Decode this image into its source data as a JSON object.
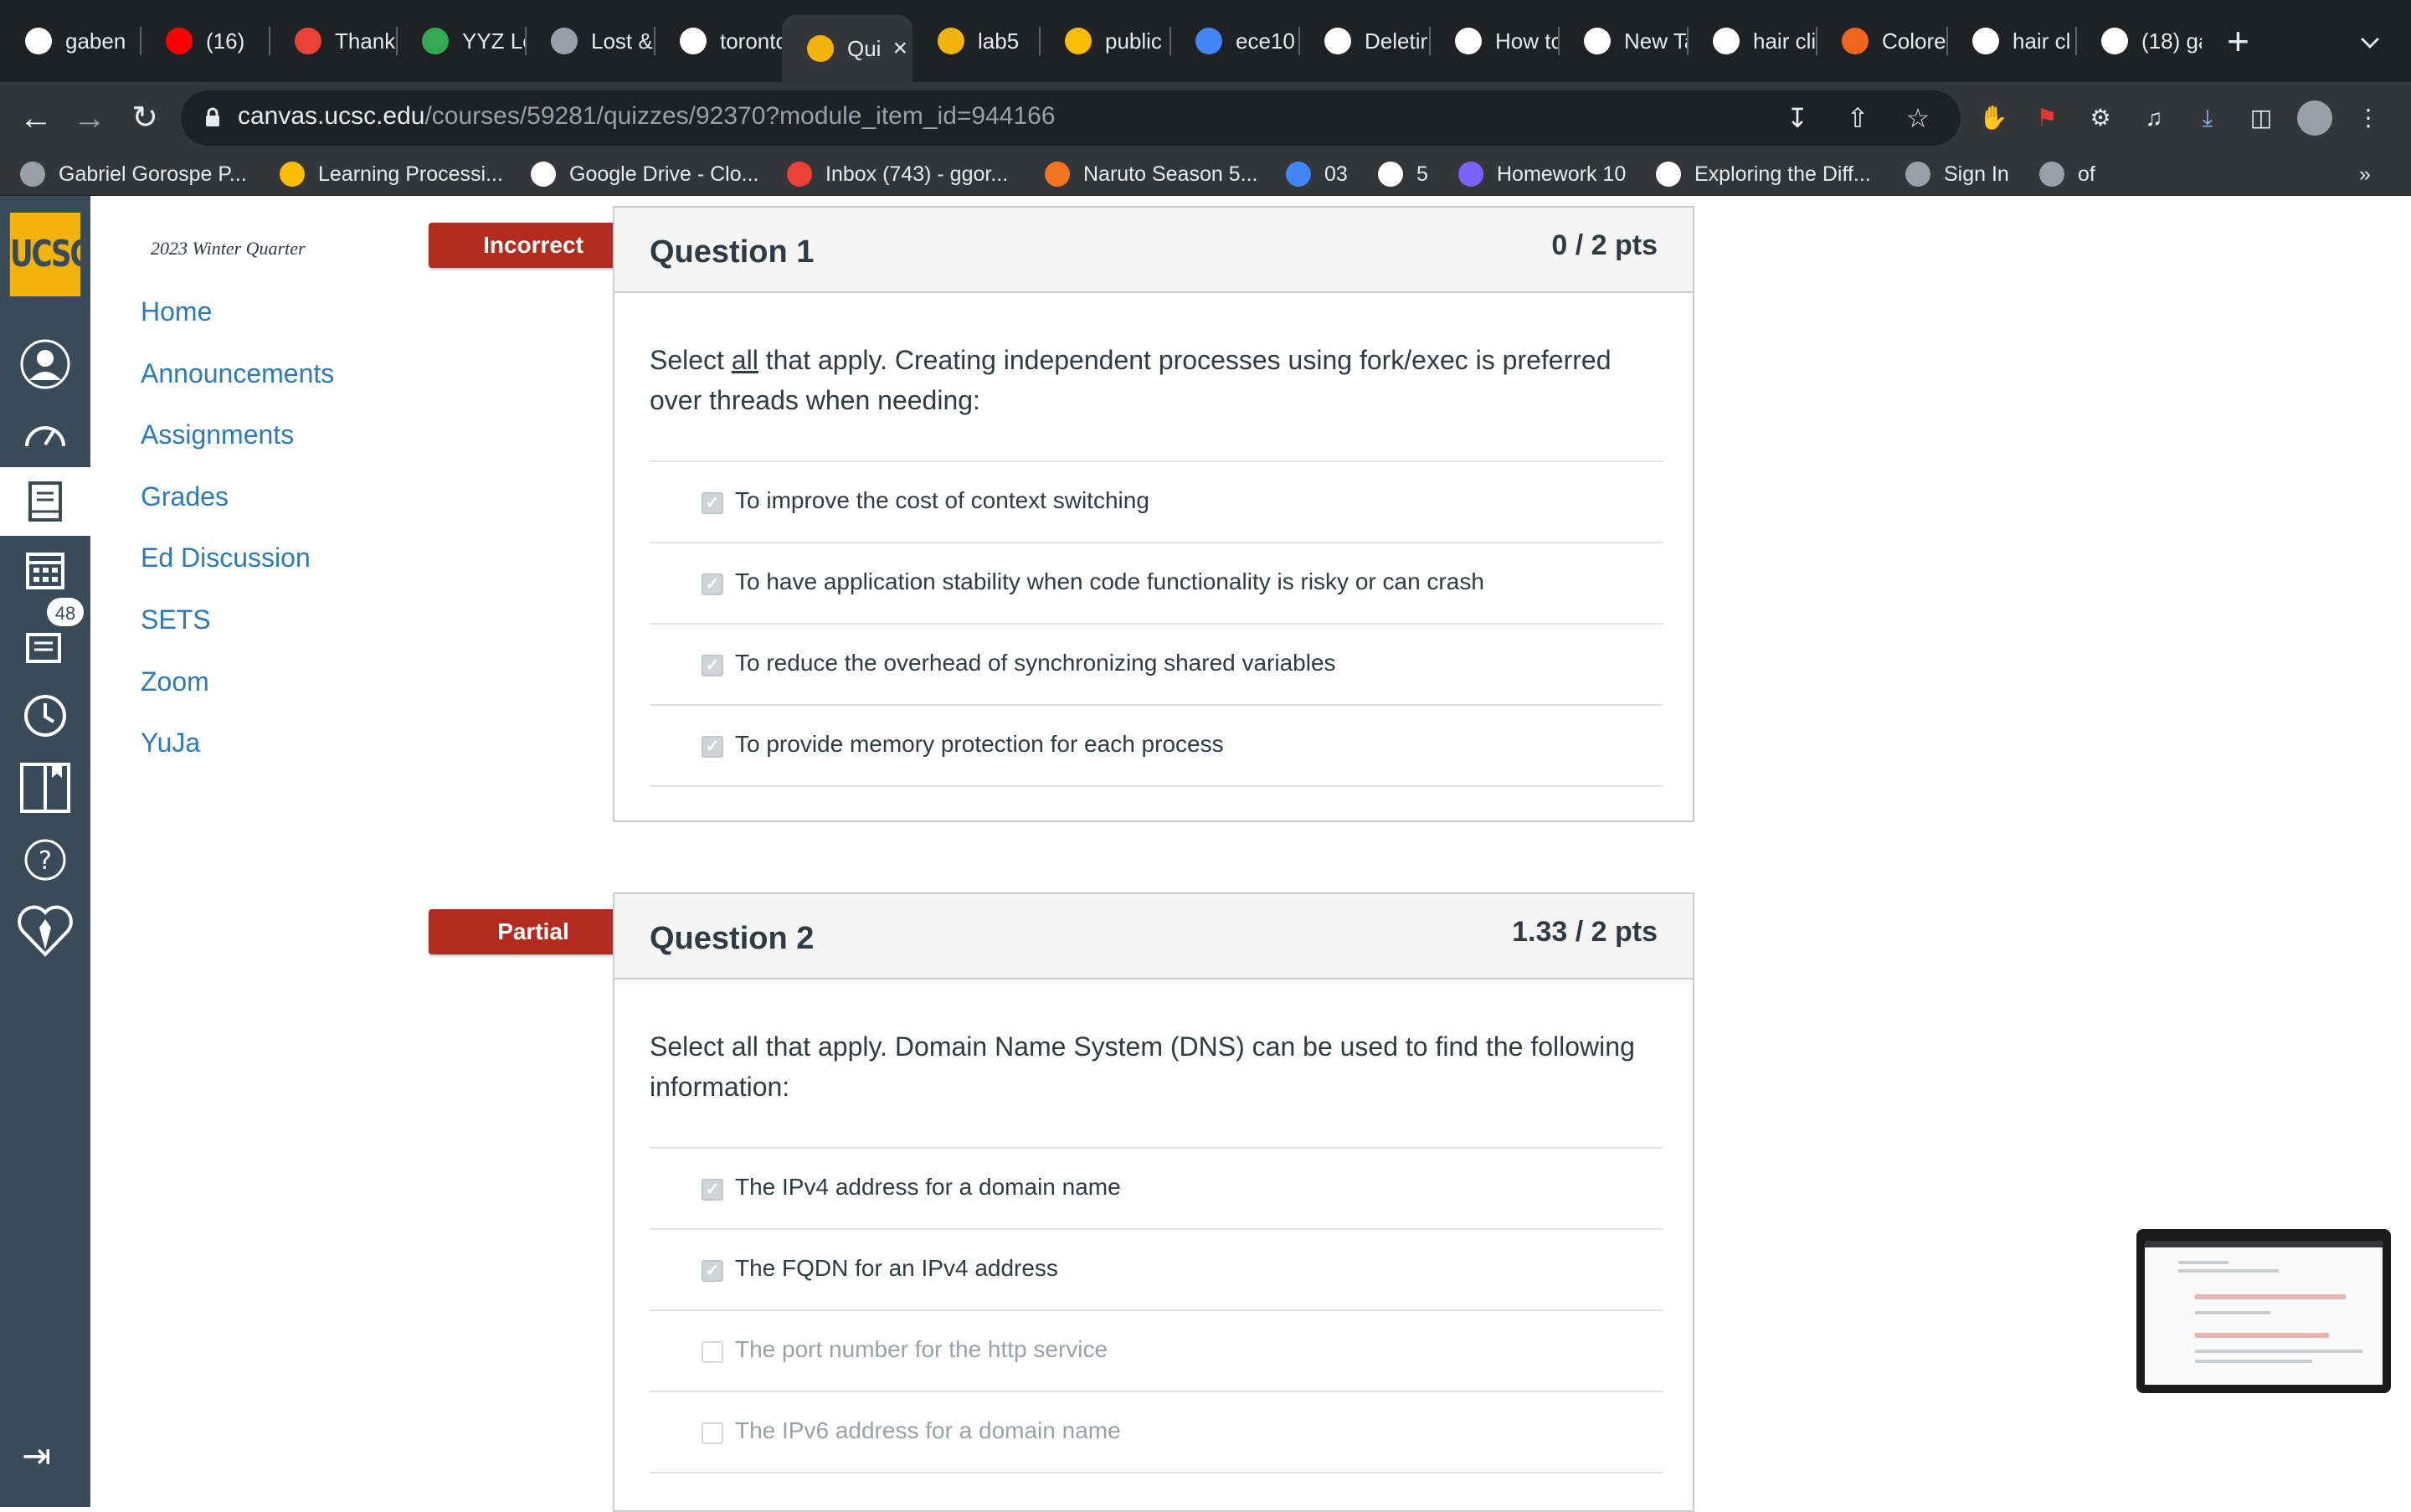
{
  "browser": {
    "tabs": [
      {
        "title": "gaben",
        "icon": "github-icon",
        "color": "#ffffff"
      },
      {
        "title": "(16)",
        "icon": "youtube-icon",
        "color": "#ff0000"
      },
      {
        "title": "Thank",
        "icon": "gmail-icon",
        "color": "#ea4335"
      },
      {
        "title": "YYZ Lc",
        "icon": "chart-icon",
        "color": "#34a853"
      },
      {
        "title": "Lost &",
        "icon": "globe-icon",
        "color": "#9aa0a6"
      },
      {
        "title": "toronto",
        "icon": "google-icon",
        "color": "#ffffff"
      },
      {
        "title": "Qui",
        "icon": "ucsc-icon",
        "color": "#f2b40c",
        "active": true
      },
      {
        "title": "lab5",
        "icon": "ucsc-icon",
        "color": "#f2b40c"
      },
      {
        "title": "public",
        "icon": "google-drive-icon",
        "color": "#fbbc04"
      },
      {
        "title": "ece10",
        "icon": "google-docs-icon",
        "color": "#4285f4"
      },
      {
        "title": "Deletir",
        "icon": "github-icon",
        "color": "#ffffff"
      },
      {
        "title": "How to",
        "icon": "notion-icon",
        "color": "#ffffff"
      },
      {
        "title": "New Ta",
        "icon": "chrome-icon",
        "color": "#ffffff"
      },
      {
        "title": "hair cli",
        "icon": "google-icon",
        "color": "#ffffff"
      },
      {
        "title": "Colore",
        "icon": "etsy-icon",
        "color": "#f1641e"
      },
      {
        "title": "hair cl",
        "icon": "google-icon",
        "color": "#ffffff"
      },
      {
        "title": "(18) ga",
        "icon": "x-icon",
        "color": "#ffffff"
      }
    ],
    "url_host": "canvas.ucsc.edu",
    "url_path": "/courses/59281/quizzes/92370?module_item_id=944166",
    "bookmarks": [
      {
        "label": "Gabriel Gorospe P...",
        "icon": "globe-icon",
        "color": "#9aa0a6"
      },
      {
        "label": "Learning Processi...",
        "icon": "google-drive-icon",
        "color": "#fbbc04"
      },
      {
        "label": "Google Drive - Clo...",
        "icon": "google-icon",
        "color": "#ffffff"
      },
      {
        "label": "Inbox (743) - ggor...",
        "icon": "gmail-icon",
        "color": "#ea4335"
      },
      {
        "label": "Naruto Season 5...",
        "icon": "crunchyroll-icon",
        "color": "#f47521"
      },
      {
        "label": "03",
        "icon": "a-icon",
        "color": "#4285f4"
      },
      {
        "label": "5",
        "icon": "google-icon",
        "color": "#ffffff"
      },
      {
        "label": "Homework 10",
        "icon": "list-icon",
        "color": "#7b61ff"
      },
      {
        "label": "Exploring the Diff...",
        "icon": "medium-icon",
        "color": "#ffffff"
      },
      {
        "label": "Sign In",
        "icon": "globe-icon",
        "color": "#9aa0a6"
      },
      {
        "label": "of",
        "icon": "globe-icon",
        "color": "#9aa0a6"
      }
    ],
    "overflow": "»"
  },
  "canvas": {
    "logo": "UCSC",
    "badge_count": "48",
    "term": "2023 Winter Quarter",
    "course_nav": [
      "Home",
      "Announcements",
      "Assignments",
      "Grades",
      "Ed Discussion",
      "SETS",
      "Zoom",
      "YuJa"
    ]
  },
  "questions": [
    {
      "status": "Incorrect",
      "title": "Question 1",
      "points": "0 / 2 pts",
      "text_pre": "Select ",
      "text_em": "all",
      "text_post": " that apply. Creating independent processes using fork/exec is preferred over threads when needing:",
      "answers": [
        {
          "label": "To improve the cost of context switching",
          "checked": true
        },
        {
          "label": "To have application stability when code functionality is risky or can crash",
          "checked": true
        },
        {
          "label": "To reduce the overhead of synchronizing shared variables",
          "checked": true
        },
        {
          "label": "To provide memory protection for each process",
          "checked": true
        }
      ]
    },
    {
      "status": "Partial",
      "title": "Question 2",
      "points": "1.33 / 2 pts",
      "text": "Select all that apply. Domain Name System (DNS) can be used to find the following information:",
      "answers": [
        {
          "label": "The IPv4 address for a domain name",
          "checked": true
        },
        {
          "label": "The FQDN for an IPv4 address",
          "checked": true
        },
        {
          "label": "The port number for the http service",
          "checked": false
        },
        {
          "label": "The IPv6 address for a domain name",
          "checked": false
        }
      ]
    }
  ],
  "colors": {
    "banner_red": "#b32b1f",
    "link_blue": "#2b7abc",
    "nav_bg": "#394b58",
    "ucsc_gold": "#f2b40c"
  }
}
